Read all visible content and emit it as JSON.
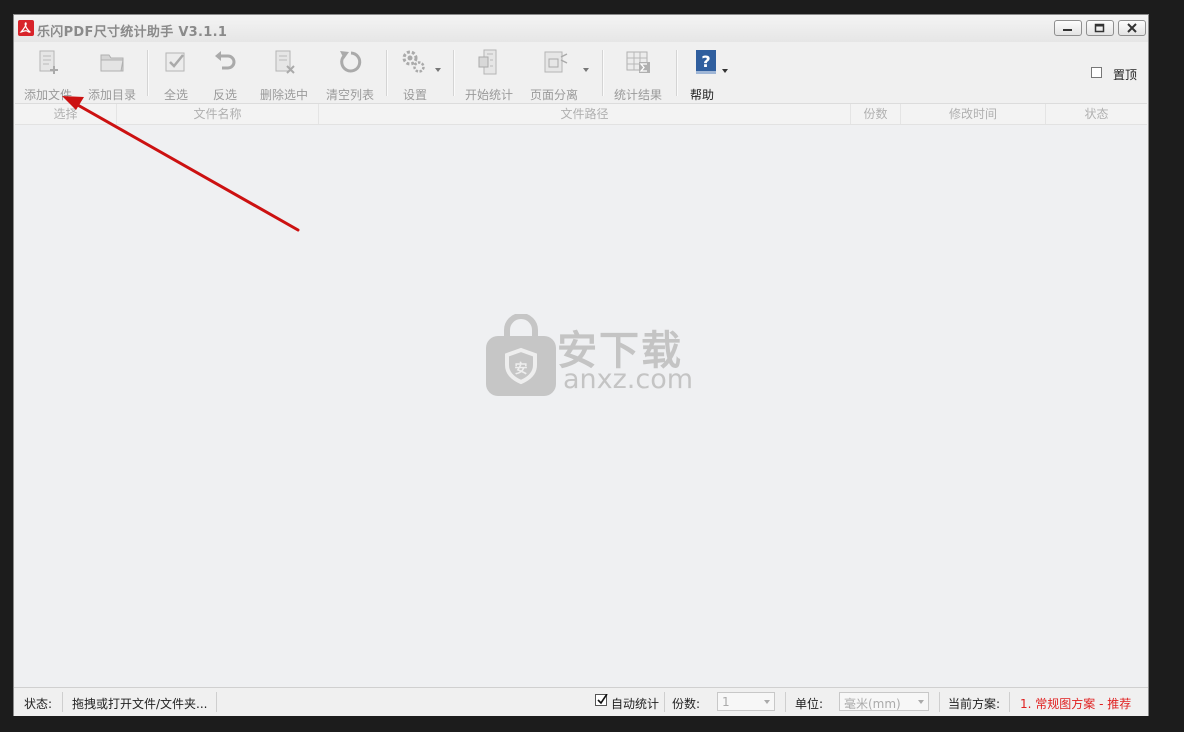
{
  "window": {
    "title": "乐闪PDF尺寸统计助手 V3.1.1"
  },
  "toolbar": {
    "add_file": "添加文件",
    "add_folder": "添加目录",
    "select_all": "全选",
    "invert_select": "反选",
    "delete_selected": "删除选中",
    "clear_list": "清空列表",
    "settings": "设置",
    "start_count": "开始统计",
    "page_split": "页面分离",
    "count_result": "统计结果",
    "help": "帮助",
    "pin_top": "置顶"
  },
  "list": {
    "columns": [
      "选择",
      "文件名称",
      "文件路径",
      "份数",
      "修改时间",
      "状态"
    ]
  },
  "watermark": {
    "cn": "安下载",
    "en": "anxz.com"
  },
  "statusbar": {
    "status_label": "状态:",
    "status_text": "拖拽或打开文件/文件夹...",
    "auto_count_label": "自动统计",
    "auto_count_checked": true,
    "copies_label": "份数:",
    "copies_value": "1",
    "unit_label": "单位:",
    "unit_value": "毫米(mm)",
    "scheme_label": "当前方案:",
    "scheme_value": "1. 常规图方案 - 推荐"
  },
  "colors": {
    "accent_red": "#e02020",
    "help_blue": "#2f5e9e",
    "arrow_red": "#cc1111"
  }
}
